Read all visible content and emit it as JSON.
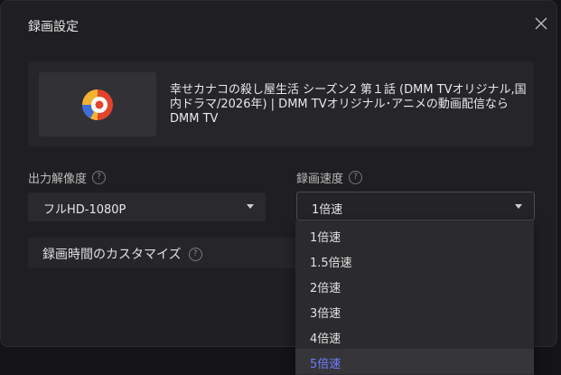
{
  "dialog": {
    "title": "録画設定",
    "close_icon": "close-icon"
  },
  "video": {
    "title": "幸せカナコの殺し屋生活 シーズン2 第１話 (DMM TVオリジナル,国内ドラマ/2026年) | DMM TVオリジナル･アニメの動画配信ならDMM TV",
    "thumbnail_icon": "dmm-tv-logo-icon"
  },
  "output_resolution": {
    "label": "出力解像度",
    "value": "フルHD-1080P"
  },
  "recording_speed": {
    "label": "録画速度",
    "value": "1倍速",
    "options": [
      "1倍速",
      "1.5倍速",
      "2倍速",
      "3倍速",
      "4倍速",
      "5倍速"
    ],
    "highlighted_index": 5
  },
  "custom_time": {
    "label": "録画時間のカスタマイズ"
  },
  "colors": {
    "dialog_bg": "#1f1f22",
    "highlight": "#6f7dff"
  }
}
